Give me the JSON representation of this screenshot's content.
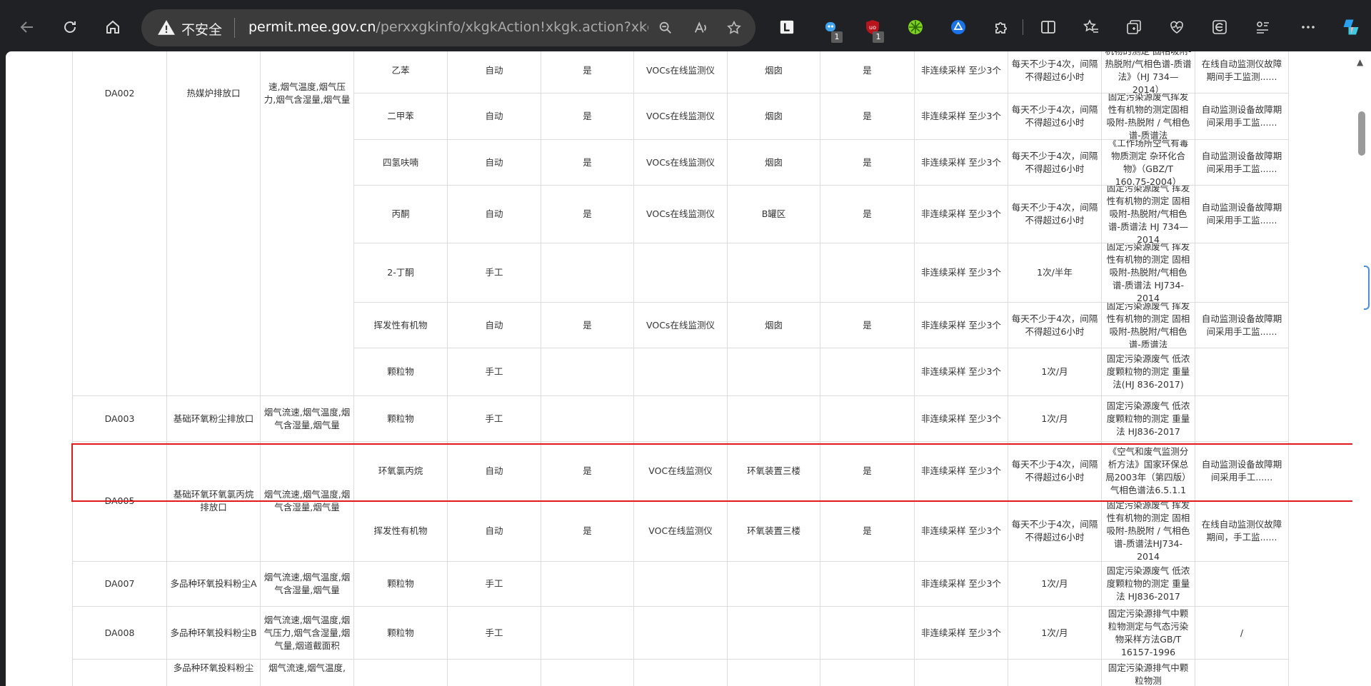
{
  "browser": {
    "security_label": "不安全",
    "url_host": "permit.mee.gov.cn",
    "url_path": "/perxxgkinfo/xkgkAction!xkgk.action?xkgk=...",
    "extension_badges": [
      "1",
      "1"
    ],
    "icons": [
      "back-icon",
      "refresh-icon",
      "home-icon",
      "warning-icon",
      "zoom-icon",
      "read-aloud-icon",
      "favorite-star-icon",
      "extension-l-icon",
      "extension-bot-icon",
      "ublock-icon",
      "extension-green-icon",
      "extension-triangle-icon",
      "puzzle-icon",
      "split-screen-icon",
      "favorites-icon",
      "collections-icon",
      "performance-icon",
      "browser-essentials-icon",
      "more-tools-icon",
      "more-icon",
      "copilot-icon"
    ]
  },
  "table": {
    "rows": [
      [
        {
          "text": "DA002",
          "name": "outlet-id"
        },
        {
          "text": "热媒炉排放口",
          "name": "outlet-name"
        },
        {
          "text": "速,烟气温度,烟气压力,烟气含湿量,烟气量",
          "name": "params"
        },
        {
          "text": "乙苯",
          "name": "pollutant"
        },
        {
          "text": "自动",
          "name": "method"
        },
        {
          "text": "是",
          "name": "networked"
        },
        {
          "text": "VOCs在线监测仪",
          "name": "instrument"
        },
        {
          "text": "烟囱",
          "name": "location"
        },
        {
          "text": "是",
          "name": "certified"
        },
        {
          "text": "非连续采样 至少3个",
          "name": "sampling"
        },
        {
          "text": "每天不少于4次，间隔不得超过6小时",
          "name": "frequency"
        },
        {
          "text": "机物的测定 固相吸附-热脱附/气相色谱-质谱法》（HJ 734—2014）",
          "name": "standard"
        },
        {
          "text": "在线自动监测仪故障期间手工监测......",
          "name": "other"
        }
      ],
      [
        {
          "text": "二甲苯",
          "name": "pollutant"
        },
        {
          "text": "自动",
          "name": "method"
        },
        {
          "text": "是",
          "name": "networked"
        },
        {
          "text": "VOCs在线监测仪",
          "name": "instrument"
        },
        {
          "text": "烟囱",
          "name": "location"
        },
        {
          "text": "是",
          "name": "certified"
        },
        {
          "text": "非连续采样 至少3个",
          "name": "sampling"
        },
        {
          "text": "每天不少于4次，间隔不得超过6小时",
          "name": "frequency"
        },
        {
          "text": "固定污染源废气挥发性有机物的测定固相吸附-热脱附 / 气相色谱-质谱法",
          "name": "standard"
        },
        {
          "text": "自动监测设备故障期间采用手工监......",
          "name": "other"
        }
      ],
      [
        {
          "text": "四氢呋喃",
          "name": "pollutant"
        },
        {
          "text": "自动",
          "name": "method"
        },
        {
          "text": "是",
          "name": "networked"
        },
        {
          "text": "VOCs在线监测仪",
          "name": "instrument"
        },
        {
          "text": "烟囱",
          "name": "location"
        },
        {
          "text": "是",
          "name": "certified"
        },
        {
          "text": "非连续采样 至少3个",
          "name": "sampling"
        },
        {
          "text": "每天不少于4次，间隔不得超过6小时",
          "name": "frequency"
        },
        {
          "text": "《工作场所空气有毒物质测定 杂环化合物》（GBZ/T 160.75-2004）",
          "name": "standard"
        },
        {
          "text": "自动监测设备故障期间采用手工监......",
          "name": "other"
        }
      ],
      [
        {
          "text": "丙酮",
          "name": "pollutant"
        },
        {
          "text": "自动",
          "name": "method"
        },
        {
          "text": "是",
          "name": "networked"
        },
        {
          "text": "VOCs在线监测仪",
          "name": "instrument"
        },
        {
          "text": "B罐区",
          "name": "location"
        },
        {
          "text": "是",
          "name": "certified"
        },
        {
          "text": "非连续采样 至少3个",
          "name": "sampling"
        },
        {
          "text": "每天不少于4次，间隔不得超过6小时",
          "name": "frequency"
        },
        {
          "text": "固定污染源废气 挥发性有机物的测定 固相吸附-热脱附/气相色谱-质谱法 HJ 734—2014",
          "name": "standard"
        },
        {
          "text": "自动监测设备故障期间采用手工监......",
          "name": "other"
        }
      ],
      [
        {
          "text": "2-丁酮",
          "name": "pollutant"
        },
        {
          "text": "手工",
          "name": "method"
        },
        {
          "text": "非连续采样 至少3个",
          "name": "sampling"
        },
        {
          "text": "1次/半年",
          "name": "frequency"
        },
        {
          "text": "固定污染源废气 挥发性有机物的测定 固相吸附-热脱附/气相色谱-质谱法 HJ734-2014",
          "name": "standard"
        }
      ],
      [
        {
          "text": "挥发性有机物",
          "name": "pollutant"
        },
        {
          "text": "自动",
          "name": "method"
        },
        {
          "text": "是",
          "name": "networked"
        },
        {
          "text": "VOCs在线监测仪",
          "name": "instrument"
        },
        {
          "text": "烟囱",
          "name": "location"
        },
        {
          "text": "是",
          "name": "certified"
        },
        {
          "text": "非连续采样 至少3个",
          "name": "sampling"
        },
        {
          "text": "每天不少于4次，间隔不得超过6小时",
          "name": "frequency"
        },
        {
          "text": "固定污染源废气 挥发性有机物的测定 固相吸附-热脱附/气相色谱-质谱法",
          "name": "standard"
        },
        {
          "text": "自动监测设备故障期间采用手工监......",
          "name": "other"
        }
      ],
      [
        {
          "text": "颗粒物",
          "name": "pollutant"
        },
        {
          "text": "手工",
          "name": "method"
        },
        {
          "text": "非连续采样 至少3个",
          "name": "sampling"
        },
        {
          "text": "1次/月",
          "name": "frequency"
        },
        {
          "text": "固定污染源废气 低浓度颗粒物的测定 重量法(HJ 836-2017)",
          "name": "standard"
        }
      ],
      [
        {
          "text": "DA003",
          "name": "outlet-id"
        },
        {
          "text": "基础环氧粉尘排放口",
          "name": "outlet-name"
        },
        {
          "text": "烟气流速,烟气温度,烟气含湿量,烟气量",
          "name": "params"
        },
        {
          "text": "颗粒物",
          "name": "pollutant"
        },
        {
          "text": "手工",
          "name": "method"
        },
        {
          "text": "非连续采样 至少3个",
          "name": "sampling"
        },
        {
          "text": "1次/月",
          "name": "frequency"
        },
        {
          "text": "固定污染源废气 低浓度颗粒物的测定 重量法 HJ836-2017",
          "name": "standard"
        }
      ],
      [
        {
          "text": "DA005",
          "name": "outlet-id"
        },
        {
          "text": "基础环氧环氧氯丙烷排放口",
          "name": "outlet-name"
        },
        {
          "text": "烟气流速,烟气温度,烟气含湿量,烟气量",
          "name": "params"
        },
        {
          "text": "环氧氯丙烷",
          "name": "pollutant"
        },
        {
          "text": "自动",
          "name": "method"
        },
        {
          "text": "是",
          "name": "networked"
        },
        {
          "text": "VOC在线监测仪",
          "name": "instrument"
        },
        {
          "text": "环氧装置三楼",
          "name": "location"
        },
        {
          "text": "是",
          "name": "certified"
        },
        {
          "text": "非连续采样 至少3个",
          "name": "sampling"
        },
        {
          "text": "每天不少于4次，间隔不得超过6小时",
          "name": "frequency"
        },
        {
          "text": "《空气和废气监测分析方法》国家环保总局2003年（第四版）气相色谱法6.5.1.1",
          "name": "standard"
        },
        {
          "text": "自动监测设备故障期间采用手工......",
          "name": "other"
        }
      ],
      [
        {
          "text": "挥发性有机物",
          "name": "pollutant"
        },
        {
          "text": "自动",
          "name": "method"
        },
        {
          "text": "是",
          "name": "networked"
        },
        {
          "text": "VOC在线监测仪",
          "name": "instrument"
        },
        {
          "text": "环氧装置三楼",
          "name": "location"
        },
        {
          "text": "是",
          "name": "certified"
        },
        {
          "text": "非连续采样 至少3个",
          "name": "sampling"
        },
        {
          "text": "每天不少于4次，间隔不得超过6小时",
          "name": "frequency"
        },
        {
          "text": "固定污染源废气 挥发性有机物的测定 固相吸附-热脱附 / 气相色谱-质谱法HJ734-2014",
          "name": "standard"
        },
        {
          "text": "在线自动监测仪故障期间，手工监......",
          "name": "other"
        }
      ],
      [
        {
          "text": "DA007",
          "name": "outlet-id"
        },
        {
          "text": "多品种环氧投料粉尘A",
          "name": "outlet-name"
        },
        {
          "text": "烟气流速,烟气温度,烟气含湿量,烟气量",
          "name": "params"
        },
        {
          "text": "颗粒物",
          "name": "pollutant"
        },
        {
          "text": "手工",
          "name": "method"
        },
        {
          "text": "非连续采样 至少3个",
          "name": "sampling"
        },
        {
          "text": "1次/月",
          "name": "frequency"
        },
        {
          "text": "固定污染源废气 低浓度颗粒物的测定 重量法 HJ836-2017",
          "name": "standard"
        }
      ],
      [
        {
          "text": "DA008",
          "name": "outlet-id"
        },
        {
          "text": "多品种环氧投料粉尘B",
          "name": "outlet-name"
        },
        {
          "text": "烟气流速,烟气温度,烟气压力,烟气含湿量,烟气量,烟道截面积",
          "name": "params"
        },
        {
          "text": "颗粒物",
          "name": "pollutant"
        },
        {
          "text": "手工",
          "name": "method"
        },
        {
          "text": "非连续采样 至少3个",
          "name": "sampling"
        },
        {
          "text": "1次/月",
          "name": "frequency"
        },
        {
          "text": "固定污染源排气中颗粒物测定与气态污染物采样方法GB/T 16157-1996",
          "name": "standard"
        },
        {
          "text": "/",
          "name": "other"
        }
      ],
      [
        {
          "text": "多品种环氧投料粉尘",
          "name": "outlet-name"
        },
        {
          "text": "烟气流速,烟气温度,",
          "name": "params"
        },
        {
          "text": "固定污染源排气中颗粒物测",
          "name": "standard"
        }
      ]
    ]
  }
}
